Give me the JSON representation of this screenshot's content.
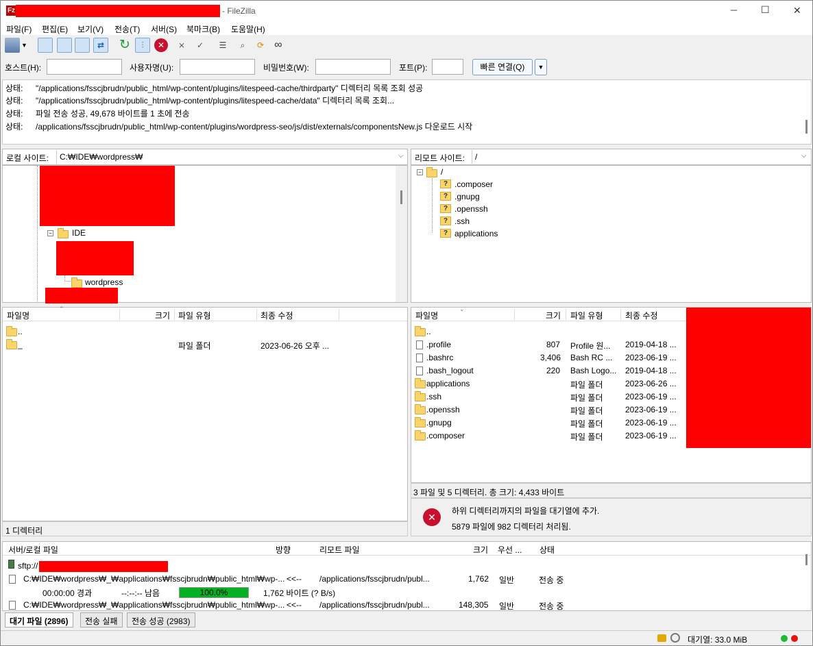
{
  "window": {
    "app_title": "- FileZilla",
    "controls": {
      "minimize": "─",
      "maximize": "☐",
      "close": "✕"
    }
  },
  "menu": [
    "파일(F)",
    "편집(E)",
    "보기(V)",
    "전송(T)",
    "서버(S)",
    "북마크(B)",
    "도움말(H)"
  ],
  "quickconnect": {
    "host_label": "호스트(H):",
    "user_label": "사용자명(U):",
    "pass_label": "비밀번호(W):",
    "port_label": "포트(P):",
    "button": "빠른 연결(Q)"
  },
  "log": [
    {
      "k": "상태:",
      "v": "\"/applications/fsscjbrudn/public_html/wp-content/plugins/litespeed-cache/thirdparty\" 디렉터리 목록 조회 성공"
    },
    {
      "k": "상태:",
      "v": "\"/applications/fsscjbrudn/public_html/wp-content/plugins/litespeed-cache/data\" 디렉터리 목록 조회..."
    },
    {
      "k": "상태:",
      "v": "파일 전송 성공, 49,678 바이트를 1 초에 전송"
    },
    {
      "k": "상태:",
      "v": "/applications/fsscjbrudn/public_html/wp-content/plugins/wordpress-seo/js/dist/externals/componentsNew.js 다운로드 시작"
    }
  ],
  "local": {
    "site_label": "로컬 사이트:",
    "path": "C:₩IDE₩wordpress₩",
    "tree": [
      {
        "label": "IDE"
      },
      {
        "label": "wordpress"
      }
    ],
    "columns": [
      "파일명",
      "크기",
      "파일 유형",
      "최종 수정"
    ],
    "files": [
      {
        "name": "..",
        "size": "",
        "type": "",
        "modified": ""
      },
      {
        "name": "_",
        "size": "",
        "type": "파일 폴더",
        "modified": "2023-06-26 오후 ..."
      }
    ],
    "status": "1 디렉터리"
  },
  "remote": {
    "site_label": "리모트 사이트:",
    "path": "/",
    "tree": [
      {
        "label": "/"
      },
      {
        "label": ".composer"
      },
      {
        "label": ".gnupg"
      },
      {
        "label": ".openssh"
      },
      {
        "label": ".ssh"
      },
      {
        "label": "applications"
      }
    ],
    "columns": [
      "파일명",
      "크기",
      "파일 유형",
      "최종 수정"
    ],
    "files": [
      {
        "name": "..",
        "size": "",
        "type": "",
        "modified": "",
        "kind": "folder"
      },
      {
        "name": ".profile",
        "size": "807",
        "type": "Profile 원...",
        "modified": "2019-04-18 ...",
        "kind": "file"
      },
      {
        "name": ".bashrc",
        "size": "3,406",
        "type": "Bash RC ...",
        "modified": "2023-06-19 ...",
        "kind": "file"
      },
      {
        "name": ".bash_logout",
        "size": "220",
        "type": "Bash Logo...",
        "modified": "2019-04-18 ...",
        "kind": "file"
      },
      {
        "name": "applications",
        "size": "",
        "type": "파일 폴더",
        "modified": "2023-06-26 ...",
        "kind": "folder"
      },
      {
        "name": ".ssh",
        "size": "",
        "type": "파일 폴더",
        "modified": "2023-06-19 ...",
        "kind": "folder"
      },
      {
        "name": ".openssh",
        "size": "",
        "type": "파일 폴더",
        "modified": "2023-06-19 ...",
        "kind": "folder"
      },
      {
        "name": ".gnupg",
        "size": "",
        "type": "파일 폴더",
        "modified": "2023-06-19 ...",
        "kind": "folder"
      },
      {
        "name": ".composer",
        "size": "",
        "type": "파일 폴더",
        "modified": "2023-06-19 ...",
        "kind": "folder"
      }
    ],
    "status": "3 파일 및 5 디렉터리. 총 크기: 4,433 바이트",
    "notice_line1": "하위 디렉터리까지의 파일을 대기열에 추가.",
    "notice_line2": "5879 파일에 982 디렉터리 처리됨."
  },
  "queue": {
    "columns": [
      "서버/로컬 파일",
      "방향",
      "리모트 파일",
      "크기",
      "우선 ...",
      "상태"
    ],
    "server": "sftp://",
    "items": [
      {
        "local": "C:₩IDE₩wordpress₩_₩applications₩fsscjbrudn₩public_html₩wp-...",
        "dir": "<<--",
        "remote": "/applications/fsscjbrudn/publ...",
        "size": "1,762",
        "priority": "일반",
        "status": "전송 중"
      },
      {
        "local": "C:₩IDE₩wordpress₩_₩applications₩fsscjbrudn₩public_html₩wp-...",
        "dir": "<<--",
        "remote": "/applications/fsscjbrudn/publ...",
        "size": "148,305",
        "priority": "일반",
        "status": "전송 중"
      }
    ],
    "progress": {
      "elapsed": "00:00:00 경과",
      "remaining": "--:--:-- 남음",
      "percent_label": "100.0%",
      "percent": 100,
      "bytes": "1,762 바이트 (? B/s)"
    }
  },
  "tabs": [
    "대기 파일 (2896)",
    "전송 실패",
    "전송 성공 (2983)"
  ],
  "bottom": {
    "queue_size": "대기열: 33.0 MiB"
  },
  "colors": {
    "redact": "#ff0000",
    "progress": "#06b025",
    "folder": "#f8d46a"
  }
}
